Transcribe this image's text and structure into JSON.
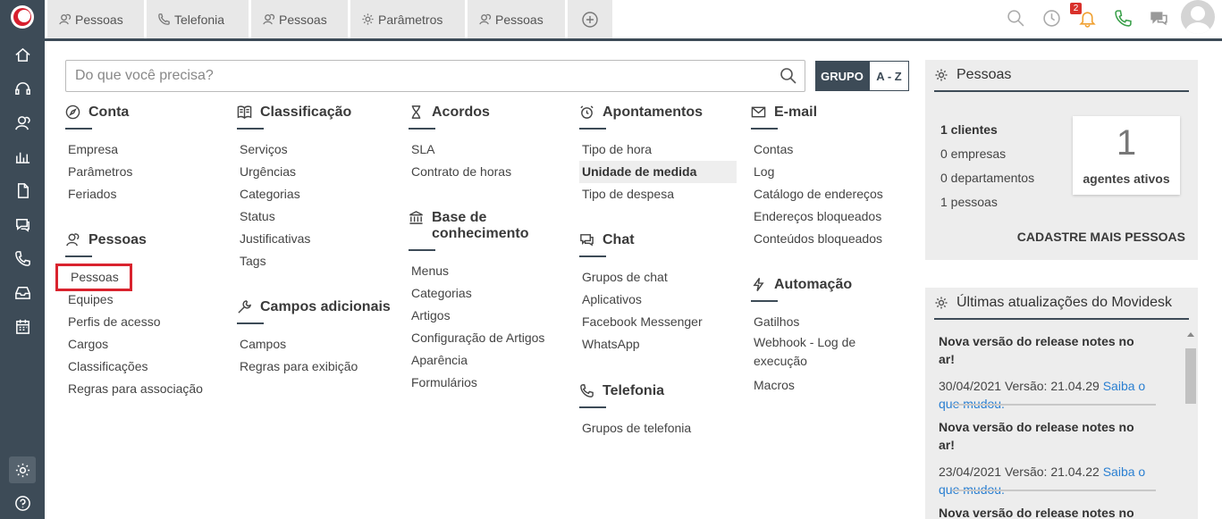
{
  "tabs": [
    {
      "label": "Pessoas",
      "icon": "people-icon"
    },
    {
      "label": "Telefonia",
      "icon": "phone-icon"
    },
    {
      "label": "Pessoas",
      "icon": "people-icon"
    },
    {
      "label": "Parâmetros",
      "icon": "gear-icon"
    },
    {
      "label": "Pessoas",
      "icon": "people-icon"
    }
  ],
  "header": {
    "notification_count": "2"
  },
  "search": {
    "placeholder": "Do que você precisa?"
  },
  "view_toggle": {
    "grupo": "GRUPO",
    "az": "A - Z"
  },
  "sections": {
    "conta": {
      "title": "Conta",
      "links": [
        "Empresa",
        "Parâmetros",
        "Feriados"
      ]
    },
    "pessoas": {
      "title": "Pessoas",
      "links": [
        "Pessoas",
        "Equipes",
        "Perfis de acesso",
        "Cargos",
        "Classificações",
        "Regras para associação"
      ]
    },
    "classificacao": {
      "title": "Classificação",
      "links": [
        "Serviços",
        "Urgências",
        "Categorias",
        "Status",
        "Justificativas",
        "Tags"
      ]
    },
    "campos": {
      "title": "Campos adicionais",
      "links": [
        "Campos",
        "Regras para exibição"
      ]
    },
    "acordos": {
      "title": "Acordos",
      "links": [
        "SLA",
        "Contrato de horas"
      ]
    },
    "base": {
      "title_line1": "Base de",
      "title_line2": "conhecimento",
      "links": [
        "Menus",
        "Categorias",
        "Artigos",
        "Configuração de Artigos",
        "Aparência",
        "Formulários"
      ]
    },
    "apontamentos": {
      "title": "Apontamentos",
      "links": [
        "Tipo de hora",
        "Unidade de medida",
        "Tipo de despesa"
      ]
    },
    "chat": {
      "title": "Chat",
      "links": [
        "Grupos de chat",
        "Aplicativos",
        "Facebook Messenger",
        "WhatsApp"
      ]
    },
    "telefonia": {
      "title": "Telefonia",
      "links": [
        "Grupos de telefonia"
      ]
    },
    "email": {
      "title": "E-mail",
      "links": [
        "Contas",
        "Log",
        "Catálogo de endereços",
        "Endereços bloqueados",
        "Conteúdos bloqueados"
      ]
    },
    "automacao": {
      "title": "Automação",
      "links": [
        "Gatilhos",
        "Webhook - Log de",
        "execução",
        "Macros"
      ]
    }
  },
  "pessoas_panel": {
    "title": "Pessoas",
    "stats": [
      "1 clientes",
      "0 empresas",
      "0 departamentos",
      "1 pessoas"
    ],
    "card_number": "1",
    "card_label": "agentes ativos",
    "cta": "CADASTRE MAIS PESSOAS"
  },
  "updates_panel": {
    "title": "Últimas atualizações do Movidesk",
    "items": [
      {
        "title": "Nova versão do release notes no ar!",
        "meta": "30/04/2021 Versão: 21.04.29 ",
        "link1": "Saiba o",
        "link2": "que mudou."
      },
      {
        "title": "Nova versão do release notes no ar!",
        "meta": "23/04/2021 Versão: 21.04.22 ",
        "link1": "Saiba o",
        "link2": "que mudou."
      },
      {
        "title": "Nova versão do release notes no ar!"
      }
    ]
  }
}
